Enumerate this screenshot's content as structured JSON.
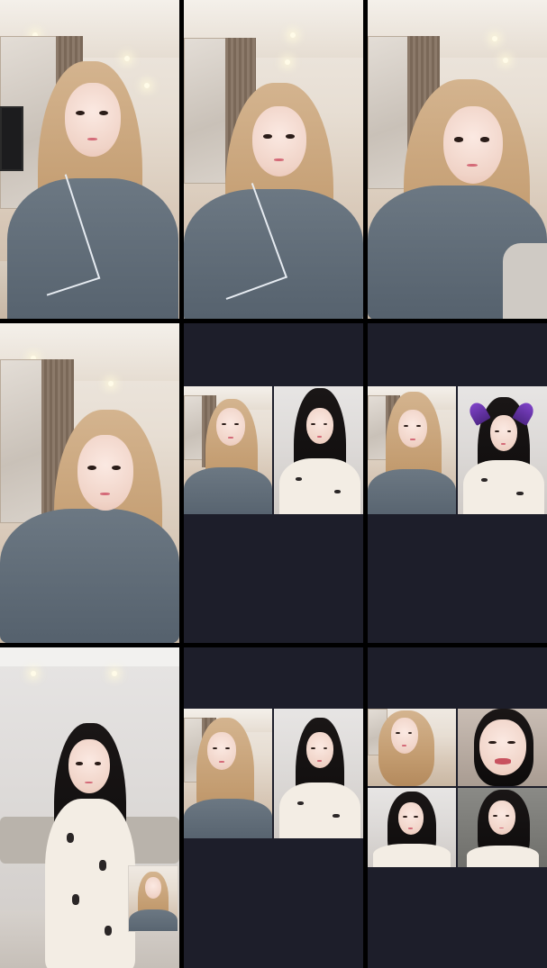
{
  "screen": {
    "description_visible_text": [],
    "background": "#000000",
    "empty_tile_color": "#1d1e2a",
    "divider_color": "#000000"
  },
  "tiles": [
    {
      "name": "tile-1",
      "kind": "single",
      "people": [
        "blond-grey-robe"
      ]
    },
    {
      "name": "tile-2",
      "kind": "single",
      "people": [
        "blond-grey-robe"
      ]
    },
    {
      "name": "tile-3",
      "kind": "single",
      "people": [
        "blond-grey-robe"
      ]
    },
    {
      "name": "tile-4",
      "kind": "single",
      "people": [
        "blond-grey-robe"
      ]
    },
    {
      "name": "tile-5",
      "kind": "split-2",
      "people": [
        "blond-grey-robe",
        "black-hair-pajama"
      ]
    },
    {
      "name": "tile-6",
      "kind": "split-2",
      "people": [
        "blond-grey-robe",
        "black-hair-pajama-devil-horns"
      ]
    },
    {
      "name": "tile-7",
      "kind": "single-with-pip",
      "people": [
        "black-hair-pajama",
        "blond-grey-robe"
      ]
    },
    {
      "name": "tile-8",
      "kind": "split-2",
      "people": [
        "blond-grey-robe",
        "black-hair-pajama"
      ]
    },
    {
      "name": "tile-9",
      "kind": "grid-4",
      "people": [
        "blond-grey-robe",
        "black-hair-smiling",
        "black-hair-pajama",
        "black-hair-pajama"
      ]
    }
  ]
}
